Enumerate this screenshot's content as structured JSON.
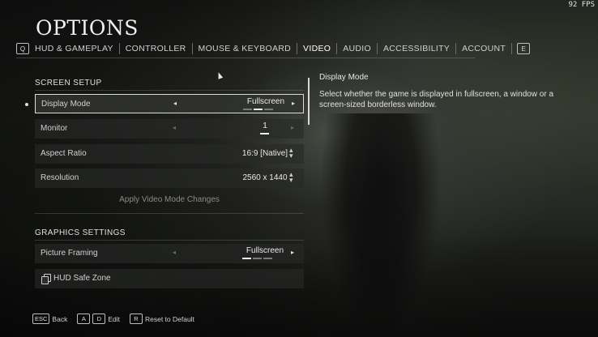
{
  "fps": "92 FPS",
  "title": "OPTIONS",
  "tabs": {
    "left_key": "Q",
    "right_key": "E",
    "items": [
      {
        "label": "HUD & GAMEPLAY"
      },
      {
        "label": "CONTROLLER"
      },
      {
        "label": "MOUSE & KEYBOARD"
      },
      {
        "label": "VIDEO"
      },
      {
        "label": "AUDIO"
      },
      {
        "label": "ACCESSIBILITY"
      },
      {
        "label": "ACCOUNT"
      }
    ],
    "active": "VIDEO"
  },
  "screen_setup": {
    "heading": "SCREEN SETUP",
    "display_mode": {
      "label": "Display Mode",
      "value": "Fullscreen"
    },
    "monitor": {
      "label": "Monitor",
      "value": "1"
    },
    "aspect_ratio": {
      "label": "Aspect Ratio",
      "value": "16:9 [Native]"
    },
    "resolution": {
      "label": "Resolution",
      "value": "2560 x 1440"
    },
    "apply": "Apply Video Mode Changes"
  },
  "graphics_settings": {
    "heading": "GRAPHICS SETTINGS",
    "picture_framing": {
      "label": "Picture Framing",
      "value": "Fullscreen"
    },
    "hud_safe_zone": {
      "label": "HUD Safe Zone"
    }
  },
  "description": {
    "title": "Display Mode",
    "body": "Select whether the game is displayed in fullscreen, a window or a screen-sized borderless window."
  },
  "footer": {
    "back_key": "ESC",
    "back_label": "Back",
    "edit_key_a": "A",
    "edit_key_d": "D",
    "edit_label": "Edit",
    "reset_key": "R",
    "reset_label": "Reset to Default"
  },
  "icons": [
    "left-arrow-icon",
    "right-arrow-icon",
    "up-down-arrows-icon",
    "copy-icon"
  ]
}
